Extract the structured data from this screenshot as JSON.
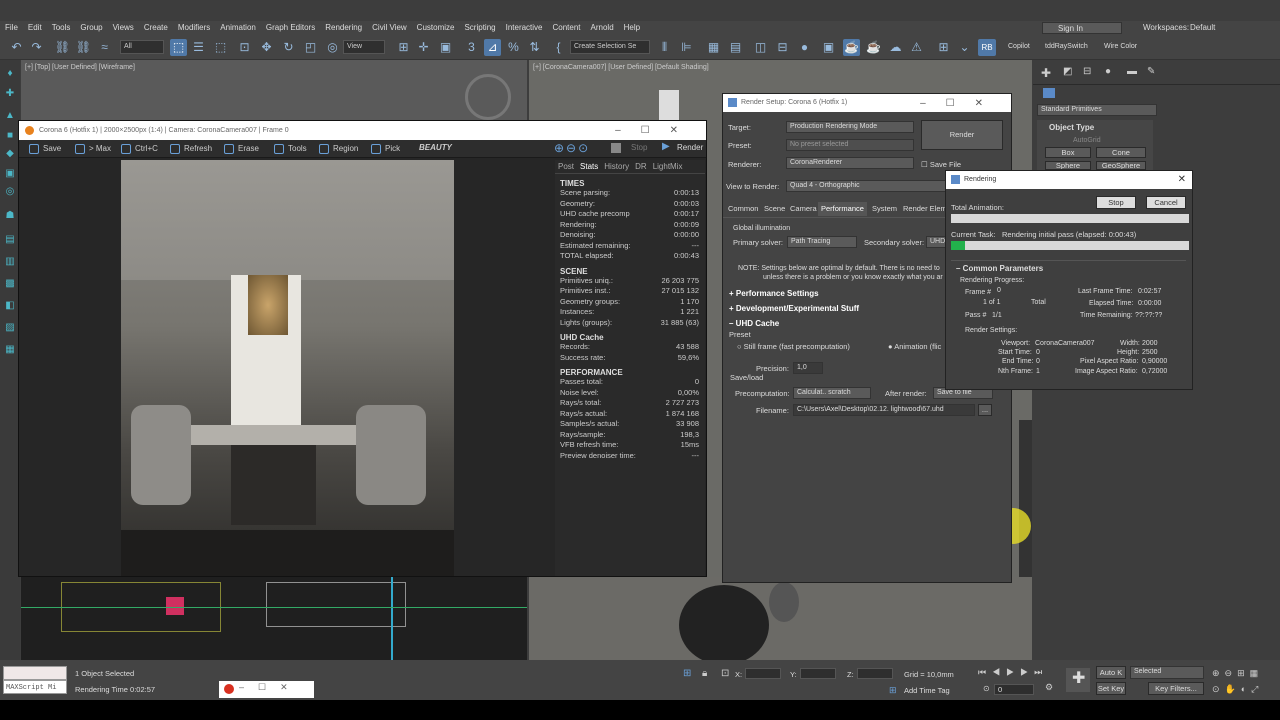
{
  "menubar": {
    "items": [
      "File",
      "Edit",
      "Tools",
      "Group",
      "Views",
      "Create",
      "Modifiers",
      "Animation",
      "Graph Editors",
      "Rendering",
      "Civil View",
      "Customize",
      "Scripting",
      "Interactive",
      "Content",
      "Arnold",
      "Help"
    ],
    "sign_in": "Sign In",
    "workspaces_label": "Workspaces:",
    "workspaces_value": "Default"
  },
  "toolbar": {
    "filter_all": "All",
    "view": "View",
    "create_selection": "Create Selection Se",
    "copilot": "Copilot",
    "ray_switch": "tddRaySwitch",
    "wire_color": "Wire Color"
  },
  "viewports": {
    "top_left_label": "[+] [Top] [User Defined] [Wireframe]",
    "top_right_label": "[+] [CoronaCamera007] [User Defined] [Default Shading]"
  },
  "vfb": {
    "title": "Corona 6 (Hotfix 1) | 2000×2500px (1:4) | Camera: CoronaCamera007 | Frame 0",
    "toolbar": [
      "Save",
      "> Max",
      "Ctrl+C",
      "Refresh",
      "Erase",
      "Tools",
      "Region",
      "Pick"
    ],
    "channel": "BEAUTY",
    "stop": "Stop",
    "render": "Render",
    "tabs": [
      "Post",
      "Stats",
      "History",
      "DR",
      "LightMix"
    ],
    "times_header": "TIMES",
    "times": [
      {
        "label": "Scene parsing:",
        "value": "0:00:13"
      },
      {
        "label": "Geometry:",
        "value": "0:00:03"
      },
      {
        "label": "UHD cache precomp",
        "value": "0:00:17"
      },
      {
        "label": "Rendering:",
        "value": "0:00:09"
      },
      {
        "label": "Denoising:",
        "value": "0:00:00"
      },
      {
        "label": "Estimated remaining:",
        "value": "---"
      },
      {
        "label": "TOTAL elapsed:",
        "value": "0:00:43"
      }
    ],
    "scene_header": "SCENE",
    "scene": [
      {
        "label": "Primitives uniq.:",
        "value": "26 203 775"
      },
      {
        "label": "Primitives inst.:",
        "value": "27 015 132"
      },
      {
        "label": "Geometry groups:",
        "value": "1 170"
      },
      {
        "label": "Instances:",
        "value": "1 221"
      },
      {
        "label": "Lights (groups):",
        "value": "31 885 (63)"
      }
    ],
    "uhd_header": "UHD Cache",
    "uhd": [
      {
        "label": "Records:",
        "value": "43 588"
      },
      {
        "label": "Success rate:",
        "value": "59,6%"
      }
    ],
    "perf_header": "PERFORMANCE",
    "perf": [
      {
        "label": "Passes total:",
        "value": "0"
      },
      {
        "label": "Noise level:",
        "value": "0,00%"
      },
      {
        "label": "Rays/s total:",
        "value": "2 727 273"
      },
      {
        "label": "Rays/s actual:",
        "value": "1 874 168"
      },
      {
        "label": "Samples/s actual:",
        "value": "33 908"
      },
      {
        "label": "Rays/sample:",
        "value": "198,3"
      },
      {
        "label": "VFB refresh time:",
        "value": "15ms"
      },
      {
        "label": "Preview denoiser time:",
        "value": "---"
      }
    ]
  },
  "render_setup": {
    "title": "Render Setup: Corona 6 (Hotfix 1)",
    "target_label": "Target:",
    "target_value": "Production Rendering Mode",
    "preset_label": "Preset:",
    "preset_value": "No preset selected",
    "renderer_label": "Renderer:",
    "renderer_value": "CoronaRenderer",
    "save_file": "Save File",
    "render_button": "Render",
    "view_label": "View to Render:",
    "view_value": "Quad 4 - Orthographic",
    "tabs": [
      "Common",
      "Scene",
      "Camera",
      "Performance",
      "System",
      "Render Elem"
    ],
    "gi_header": "Global illumination",
    "primary_label": "Primary solver:",
    "primary_value": "Path Tracing",
    "secondary_label": "Secondary solver:",
    "secondary_value": "UHD",
    "note_line1": "NOTE: Settings below are optimal by default. There is no need to",
    "note_line2": "unless there is a problem or you know exactly what you ar",
    "sec_perf": "Performance Settings",
    "sec_dev": "Development/Experimental Stuff",
    "sec_uhd": "UHD Cache",
    "preset_hdr": "Preset",
    "still_frame": "Still frame (fast precomputation)",
    "animation": "Animation (flic",
    "precision_label": "Precision:",
    "precision_value": "1,0",
    "saveload": "Save/load",
    "precomp_label": "Precomputation:",
    "precomp_value": "Calculat.. scratch",
    "after_label": "After render:",
    "after_value": "Save to file",
    "filename_label": "Filename:",
    "filename_value": "C:\\Users\\Axel\\Desktop\\02.12. lightwood\\67.uhd",
    "browse": "..."
  },
  "rendering": {
    "title": "Rendering",
    "total_animation": "Total Animation:",
    "stop": "Stop",
    "cancel": "Cancel",
    "current_task_label": "Current Task:",
    "current_task": "Rendering initial pass (elapsed: 0:00:43)",
    "total_progress": 0.0,
    "task_progress": 0.06,
    "common_params": "Common Parameters",
    "rendering_progress": "Rendering Progress:",
    "frame_label": "Frame #",
    "frame": "0",
    "of_label": "1 of 1",
    "total": "Total",
    "pass_label": "Pass #",
    "pass": "1/1",
    "last_frame_time_label": "Last Frame Time:",
    "last_frame_time": "0:02:57",
    "elapsed_label": "Elapsed Time:",
    "elapsed": "0:00:00",
    "remaining_label": "Time Remaining:",
    "remaining": "??:??:??",
    "render_settings": "Render Settings:",
    "viewport_label": "Viewport:",
    "viewport": "CoronaCamera007",
    "start_label": "Start Time:",
    "start": "0",
    "end_label": "End Time:",
    "end": "0",
    "nth_label": "Nth Frame:",
    "nth": "1",
    "width_label": "Width:",
    "width": "2000",
    "height_label": "Height:",
    "height": "2500",
    "pixel_aspect_label": "Pixel Aspect Ratio:",
    "pixel_aspect": "0,90000",
    "image_aspect_label": "Image Aspect Ratio:",
    "image_aspect": "0,72000"
  },
  "cmdpanel": {
    "category": "Standard Primitives",
    "object_type": "Object Type",
    "autogrid": "AutoGrid",
    "box": "Box",
    "cone": "Cone",
    "sphere": "Sphere",
    "geosphere": "GeoSphere"
  },
  "status": {
    "maxscript": "MAXScript Mi",
    "selected": "1 Object Selected",
    "render_time": "Rendering Time 0:02:57",
    "x": "X:",
    "y": "Y:",
    "z": "Z:",
    "grid": "Grid = 10,0mm",
    "add_time_tag": "Add Time Tag",
    "auto_key": "Auto K",
    "selected_dd": "Selected",
    "set_key": "Set Key",
    "key_filters": "Key Filters...",
    "frame": "0"
  }
}
